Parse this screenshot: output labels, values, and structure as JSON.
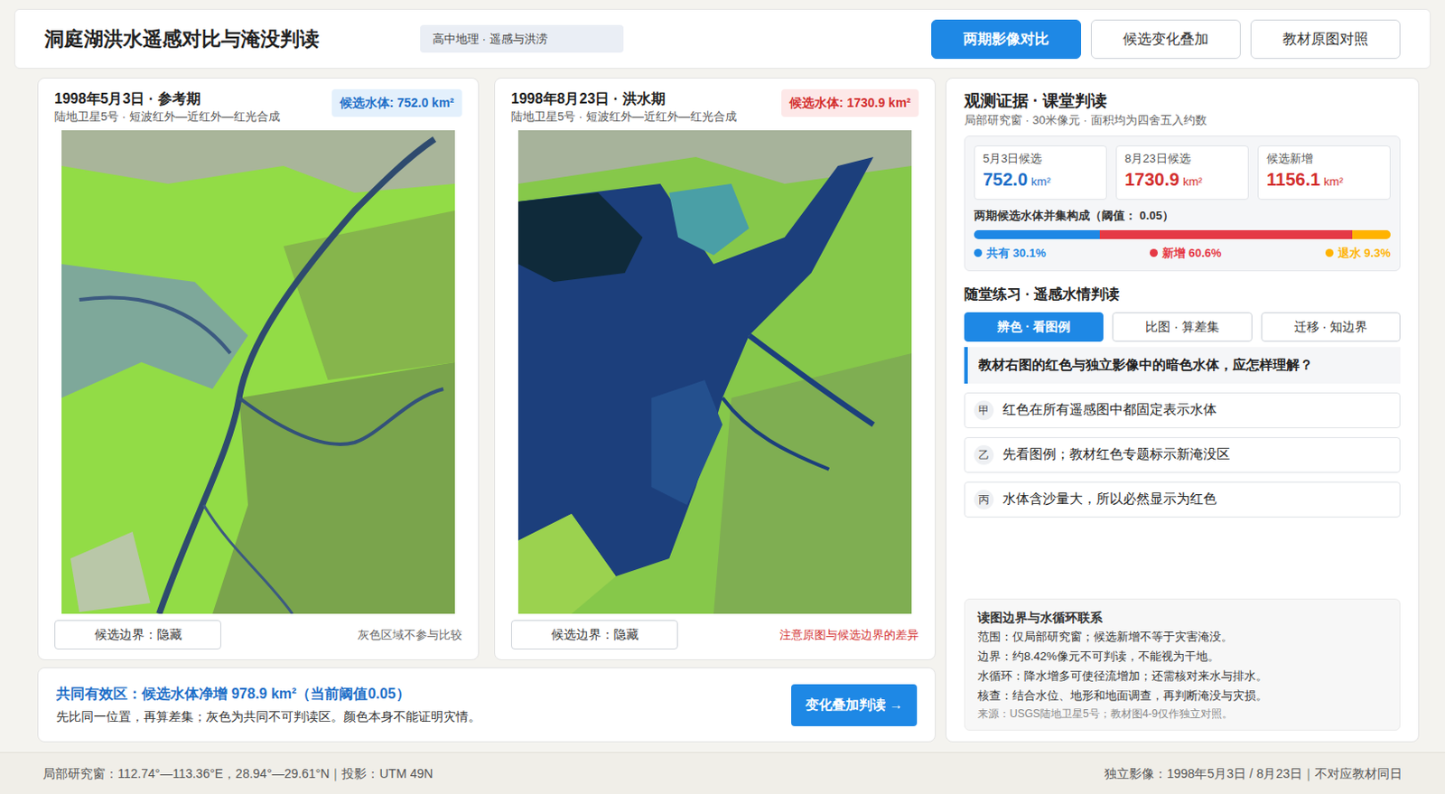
{
  "header": {
    "title": "洞庭湖洪水遥感对比与淹没判读",
    "badge": "高中地理 · 遥感与洪涝",
    "tabs": [
      {
        "label": "两期影像对比",
        "selected": true
      },
      {
        "label": "候选变化叠加",
        "selected": false
      },
      {
        "label": "教材原图对照",
        "selected": false
      }
    ]
  },
  "images": [
    {
      "kind": "reference",
      "title": "1998年5月3日 · 参考期",
      "subtitle": "陆地卫星5号 · 短波红外—近红外—红光合成",
      "badge": "候选水体: 752.0 km²",
      "toggle": "候选边界：隐藏",
      "note": "灰色区域不参与比较"
    },
    {
      "kind": "flood",
      "title": "1998年8月23日 · 洪水期",
      "subtitle": "陆地卫星5号 · 短波红外—近红外—红光合成",
      "badge": "候选水体: 1730.9 km²",
      "toggle": "候选边界：隐藏",
      "note": "注意原图与候选边界的差异"
    }
  ],
  "summary": {
    "headline": "共同有效区：候选水体净增 978.9 km²（当前阈值0.05）",
    "text": "先比同一位置，再算差集；灰色为共同不可判读区。颜色本身不能证明灾情。",
    "button": "变化叠加判读 →"
  },
  "evidence": {
    "title": "观测证据 · 课堂判读",
    "subtitle": "局部研究窗 · 30米像元 · 面积均为四舍五入约数",
    "stats": [
      {
        "label": "5月3日候选",
        "value": "752.0",
        "unit": "km²",
        "color": "#1e6fc8"
      },
      {
        "label": "8月23日候选",
        "value": "1730.9",
        "unit": "km²",
        "color": "#d32f2f"
      },
      {
        "label": "候选新增",
        "value": "1156.1",
        "unit": "km²",
        "color": "#d32f2f"
      }
    ],
    "composition": {
      "label": "两期候选水体并集构成（阈值： 0.05）",
      "segments": [
        {
          "label": "共有 30.1%",
          "level": 0.301,
          "color": "#1e88e5"
        },
        {
          "label": "新增 60.6%",
          "level": 0.606,
          "color": "#e53945"
        },
        {
          "label": "退水 9.3%",
          "level": 0.093,
          "color": "#ffb300"
        }
      ]
    }
  },
  "practice": {
    "title": "随堂练习 · 遥感水情判读",
    "tabs": [
      {
        "label": "辨色 · 看图例",
        "selected": true
      },
      {
        "label": "比图 · 算差集",
        "selected": false
      },
      {
        "label": "迁移 · 知边界",
        "selected": false
      }
    ],
    "question": "教材右图的红色与独立影像中的暗色水体，应怎样理解？",
    "options": [
      {
        "marker": "甲",
        "text": "红色在所有遥感图中都固定表示水体"
      },
      {
        "marker": "乙",
        "text": "先看图例；教材红色专题标示新淹没区"
      },
      {
        "marker": "丙",
        "text": "水体含沙量大，所以必然显示为红色"
      }
    ]
  },
  "notes": {
    "title": "读图边界与水循环联系",
    "lines": [
      "范围：仅局部研究窗；候选新增不等于灾害淹没。",
      "边界：约8.42%像元不可判读，不能视为干地。",
      "水循环：降水增多可使径流增加；还需核对来水与排水。",
      "核查：结合水位、地形和地面调查，再判断淹没与灾损。"
    ],
    "source": "来源：USGS陆地卫星5号；教材图4-9仅作独立对照。"
  },
  "footer": {
    "left": "局部研究窗：112.74°—113.36°E，28.94°—29.61°N｜投影：UTM 49N",
    "right": "独立影像：1998年5月3日 / 8月23日｜不对应教材同日"
  }
}
